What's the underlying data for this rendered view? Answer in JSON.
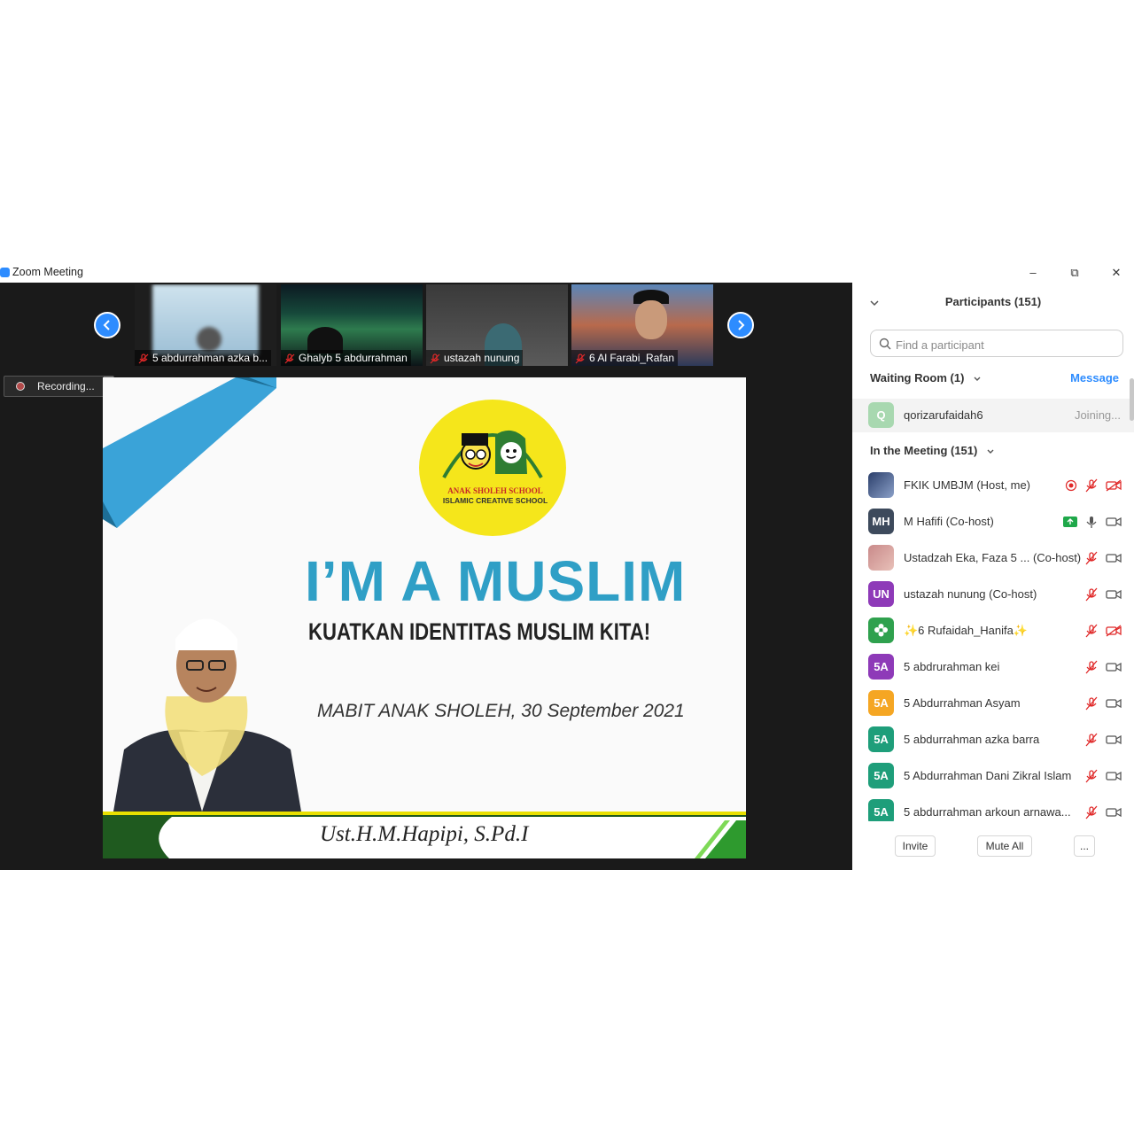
{
  "window": {
    "title": "Zoom Meeting",
    "controls": {
      "minimize": "–",
      "restore": "⧉",
      "close": "✕"
    }
  },
  "gallery": {
    "prev_icon": "chevron-left-icon",
    "next_icon": "chevron-right-icon",
    "thumbnails": [
      {
        "name": "5 abdurrahman azka b..."
      },
      {
        "name": "Ghalyb 5 abdurrahman"
      },
      {
        "name": "ustazah nunung"
      },
      {
        "name": "6 Al Farabi_Rafan"
      }
    ]
  },
  "recording": {
    "label": "Recording..."
  },
  "slide": {
    "logo_line1": "ANAK SHOLEH SCHOOL",
    "logo_line2": "ISLAMIC CREATIVE SCHOOL",
    "title": "I’M A MUSLIM",
    "subtitle": "KUATKAN IDENTITAS MUSLIM KITA!",
    "event": "MABIT ANAK SHOLEH, 30 September 2021",
    "speaker": "Ust.H.M.Hapipi, S.Pd.I"
  },
  "panel": {
    "title": "Participants (151)",
    "search_placeholder": "Find a participant",
    "waiting_room": {
      "label": "Waiting Room (1)",
      "message_label": "Message",
      "person": {
        "initial": "Q",
        "name": "qorizarufaidah6",
        "status": "Joining..."
      }
    },
    "in_meeting": {
      "label": "In the Meeting (151)",
      "participants": [
        {
          "avatar": "",
          "name": "FKIK UMBJM (Host, me)"
        },
        {
          "avatar": "MH",
          "name": "M Hafifi (Co-host)"
        },
        {
          "avatar": "",
          "name": "Ustadzah Eka, Faza 5 ...  (Co-host)"
        },
        {
          "avatar": "UN",
          "name": "ustazah nunung (Co-host)"
        },
        {
          "avatar": "",
          "name": "✨6 Rufaidah_Hanifa✨"
        },
        {
          "avatar": "5A",
          "name": "5 abdrurahman kei"
        },
        {
          "avatar": "5A",
          "name": "5 Abdurrahman Asyam"
        },
        {
          "avatar": "5A",
          "name": "5 abdurrahman azka barra"
        },
        {
          "avatar": "5A",
          "name": "5 Abdurrahman Dani Zikral Islam"
        },
        {
          "avatar": "5A",
          "name": "5 abdurrahman arkoun arnawa..."
        }
      ]
    },
    "footer": {
      "invite": "Invite",
      "mute_all": "Mute All",
      "more": "..."
    }
  },
  "colors": {
    "zoom_blue": "#2d8cff",
    "muted_red": "#e02828",
    "slide_title": "#2f9fc6",
    "logo_yellow": "#f5e61b"
  }
}
